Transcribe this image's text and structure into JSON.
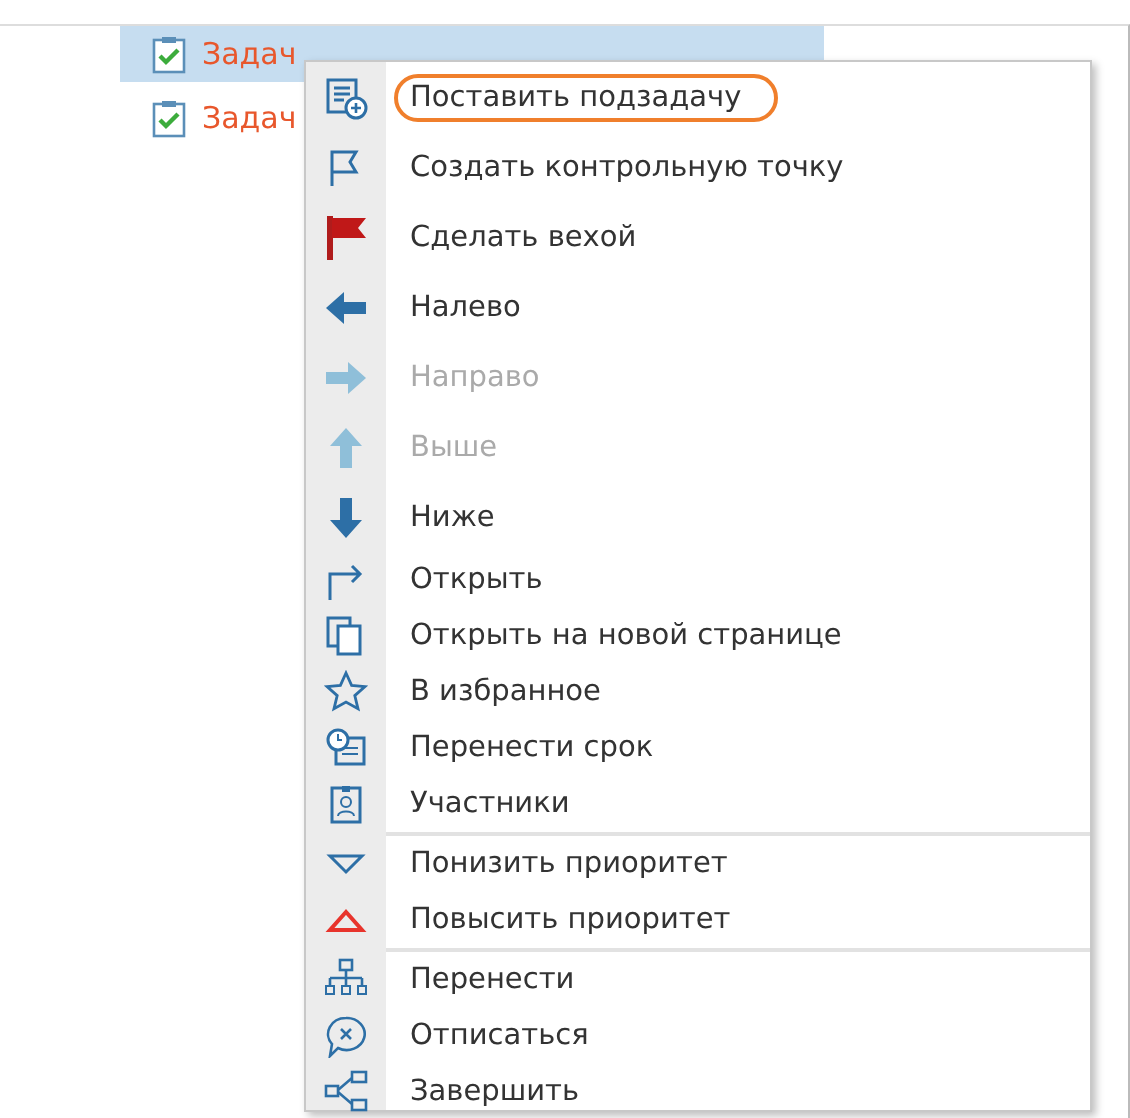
{
  "tasks": [
    {
      "title": "Задач",
      "selected": true
    },
    {
      "title": "Задач",
      "selected": false
    }
  ],
  "context_menu": {
    "groups": [
      [
        {
          "label": "Поставить подзадачу",
          "disabled": false,
          "highlighted": true
        },
        {
          "label": "Создать контрольную точку",
          "disabled": false,
          "highlighted": false
        },
        {
          "label": "Сделать вехой",
          "disabled": false,
          "highlighted": false
        },
        {
          "label": "Налево",
          "disabled": false,
          "highlighted": false
        },
        {
          "label": "Направо",
          "disabled": true,
          "highlighted": false
        },
        {
          "label": "Выше",
          "disabled": true,
          "highlighted": false
        },
        {
          "label": "Ниже",
          "disabled": false,
          "highlighted": false
        },
        {
          "label": "Открыть",
          "disabled": false,
          "highlighted": false
        },
        {
          "label": "Открыть на новой странице",
          "disabled": false,
          "highlighted": false
        },
        {
          "label": "В избранное",
          "disabled": false,
          "highlighted": false
        },
        {
          "label": "Перенести срок",
          "disabled": false,
          "highlighted": false
        },
        {
          "label": "Участники",
          "disabled": false,
          "highlighted": false
        }
      ],
      [
        {
          "label": "Понизить приоритет",
          "disabled": false,
          "highlighted": false
        },
        {
          "label": "Повысить приоритет",
          "disabled": false,
          "highlighted": false
        }
      ],
      [
        {
          "label": "Перенести",
          "disabled": false,
          "highlighted": false
        },
        {
          "label": "Отписаться",
          "disabled": false,
          "highlighted": false
        },
        {
          "label": "Завершить",
          "disabled": false,
          "highlighted": false
        }
      ]
    ]
  }
}
